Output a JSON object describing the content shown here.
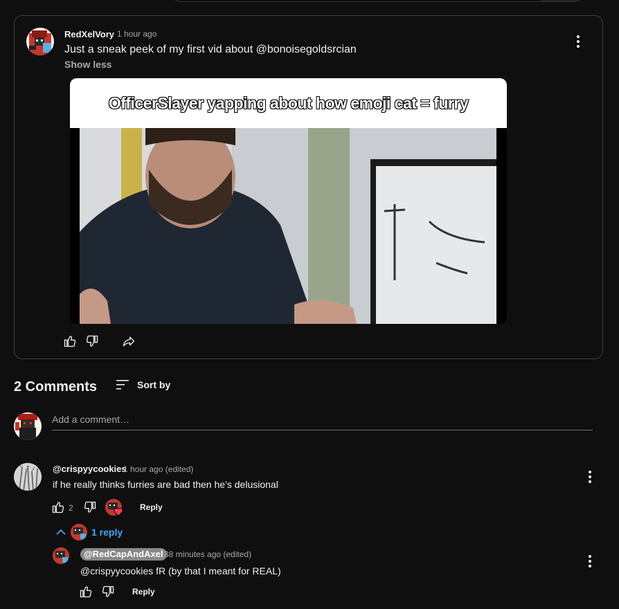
{
  "post": {
    "author": "RedXelVory",
    "time": "1 hour ago",
    "text": "Just a sneak peek of my first vid about  @bonoisegoldsrcian",
    "show_less": "Show less",
    "video_caption": "OfficerSlayer yapping about how emoji cat = furry"
  },
  "comments_header": {
    "title": "2 Comments",
    "sort_label": "Sort by"
  },
  "add_comment": {
    "placeholder": "Add a comment…"
  },
  "comments": [
    {
      "handle": "@crispyycookies",
      "time": "1 hour ago (edited)",
      "text": "if he really thinks furries are bad then he’s delusional",
      "likes": "2",
      "reply_label": "Reply",
      "replies_toggle": "1 reply"
    }
  ],
  "replies": [
    {
      "handle": "@RedCapAndAxel",
      "time": "38 minutes ago (edited)",
      "text": "@crispyycookies  fR (by that I meant for REAL)",
      "reply_label": "Reply"
    }
  ],
  "colors": {
    "background": "#0f0f0f",
    "link_blue": "#3ea6ff",
    "text_secondary": "#aaaaaa",
    "avatar_red": "#c0392b"
  },
  "icons": [
    "thumbs-up-icon",
    "thumbs-down-icon",
    "share-icon",
    "sort-icon",
    "chevron-up-icon",
    "more-vert-icon",
    "heart-icon"
  ]
}
